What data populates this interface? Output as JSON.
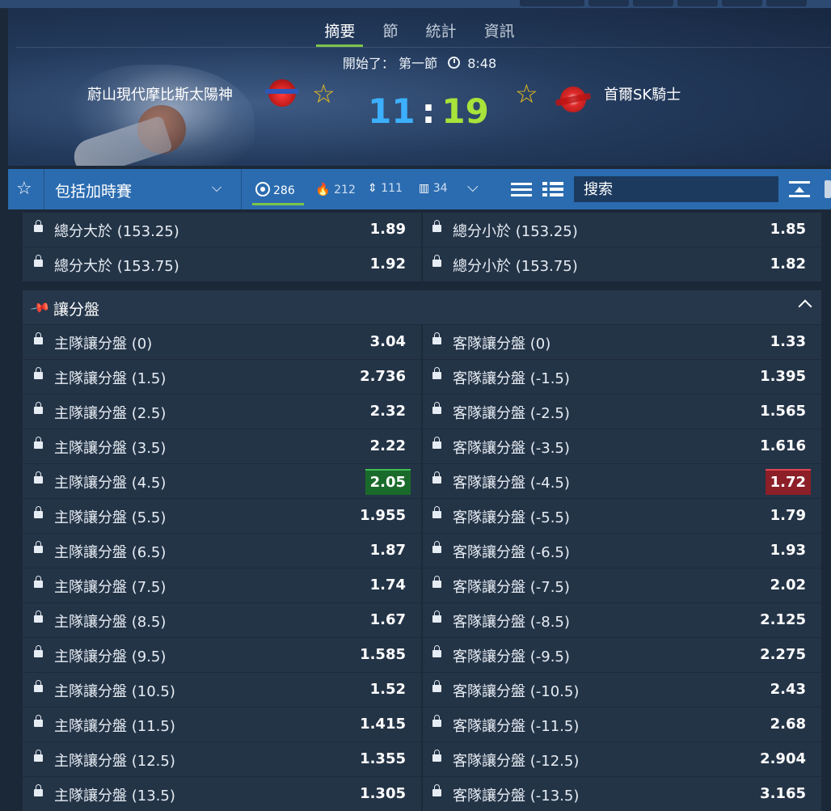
{
  "tabs": [
    "摘要",
    "節",
    "統計",
    "資訊"
  ],
  "status": {
    "prefix": "開始了：",
    "period": "第一節",
    "time": "8:48"
  },
  "match": {
    "home": "蔚山現代摩比斯太陽神",
    "away": "首爾SK騎士",
    "home_score": "11",
    "away_score": "19",
    "separator": ":"
  },
  "toolbar": {
    "period_select": "包括加時賽",
    "filters": [
      {
        "icon": "target-icon",
        "count": "286"
      },
      {
        "icon": "fire-icon",
        "count": "212"
      },
      {
        "icon": "updown-icon",
        "count": "111"
      },
      {
        "icon": "chart-icon",
        "count": "34"
      }
    ],
    "search_placeholder": "搜索"
  },
  "colors": {
    "accent": "#7cc44b",
    "toolbar": "#2b6cb0",
    "up": "#1a6b2b",
    "down": "#8c1f27",
    "home_score": "#3cb0ff",
    "away_score": "#a8e23a"
  },
  "totals": [
    {
      "l_label": "總分大於 (153.25)",
      "l_odds": "1.89",
      "r_label": "總分小於 (153.25)",
      "r_odds": "1.85"
    },
    {
      "l_label": "總分大於 (153.75)",
      "l_odds": "1.92",
      "r_label": "總分小於 (153.75)",
      "r_odds": "1.82"
    }
  ],
  "handicap": {
    "title": "讓分盤",
    "rows": [
      {
        "l_label": "主隊讓分盤 (0)",
        "l_odds": "3.04",
        "r_label": "客隊讓分盤 (0)",
        "r_odds": "1.33"
      },
      {
        "l_label": "主隊讓分盤 (1.5)",
        "l_odds": "2.736",
        "r_label": "客隊讓分盤 (-1.5)",
        "r_odds": "1.395"
      },
      {
        "l_label": "主隊讓分盤 (2.5)",
        "l_odds": "2.32",
        "r_label": "客隊讓分盤 (-2.5)",
        "r_odds": "1.565"
      },
      {
        "l_label": "主隊讓分盤 (3.5)",
        "l_odds": "2.22",
        "r_label": "客隊讓分盤 (-3.5)",
        "r_odds": "1.616"
      },
      {
        "l_label": "主隊讓分盤 (4.5)",
        "l_odds": "2.05",
        "r_label": "客隊讓分盤 (-4.5)",
        "r_odds": "1.72",
        "l_trend": "up",
        "r_trend": "down"
      },
      {
        "l_label": "主隊讓分盤 (5.5)",
        "l_odds": "1.955",
        "r_label": "客隊讓分盤 (-5.5)",
        "r_odds": "1.79"
      },
      {
        "l_label": "主隊讓分盤 (6.5)",
        "l_odds": "1.87",
        "r_label": "客隊讓分盤 (-6.5)",
        "r_odds": "1.93"
      },
      {
        "l_label": "主隊讓分盤 (7.5)",
        "l_odds": "1.74",
        "r_label": "客隊讓分盤 (-7.5)",
        "r_odds": "2.02"
      },
      {
        "l_label": "主隊讓分盤 (8.5)",
        "l_odds": "1.67",
        "r_label": "客隊讓分盤 (-8.5)",
        "r_odds": "2.125"
      },
      {
        "l_label": "主隊讓分盤 (9.5)",
        "l_odds": "1.585",
        "r_label": "客隊讓分盤 (-9.5)",
        "r_odds": "2.275"
      },
      {
        "l_label": "主隊讓分盤 (10.5)",
        "l_odds": "1.52",
        "r_label": "客隊讓分盤 (-10.5)",
        "r_odds": "2.43"
      },
      {
        "l_label": "主隊讓分盤 (11.5)",
        "l_odds": "1.415",
        "r_label": "客隊讓分盤 (-11.5)",
        "r_odds": "2.68"
      },
      {
        "l_label": "主隊讓分盤 (12.5)",
        "l_odds": "1.355",
        "r_label": "客隊讓分盤 (-12.5)",
        "r_odds": "2.904"
      },
      {
        "l_label": "主隊讓分盤 (13.5)",
        "l_odds": "1.305",
        "r_label": "客隊讓分盤 (-13.5)",
        "r_odds": "3.165"
      }
    ]
  }
}
